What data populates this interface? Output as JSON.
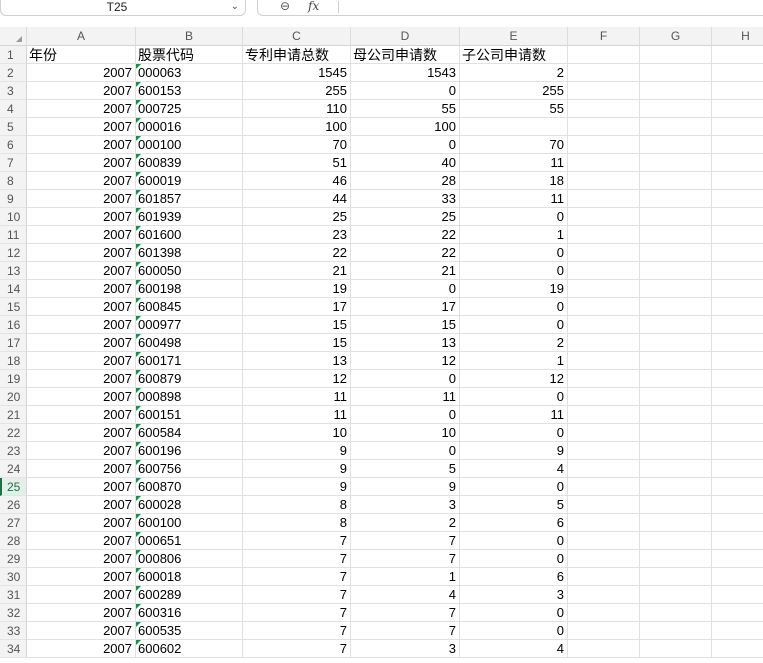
{
  "formula_bar": {
    "name_box": "T25",
    "fx_label": "fx"
  },
  "columns": [
    "A",
    "B",
    "C",
    "D",
    "E",
    "F",
    "G",
    "H"
  ],
  "header_row": {
    "row_number": "1",
    "cells": [
      "年份",
      "股票代码",
      "专利申请总数",
      "母公司申请数",
      "子公司申请数"
    ]
  },
  "active_row": "25",
  "rows": [
    {
      "n": "2",
      "year": "2007",
      "code": "000063",
      "total": "1545",
      "parent": "1543",
      "sub": "2"
    },
    {
      "n": "3",
      "year": "2007",
      "code": "600153",
      "total": "255",
      "parent": "0",
      "sub": "255"
    },
    {
      "n": "4",
      "year": "2007",
      "code": "000725",
      "total": "110",
      "parent": "55",
      "sub": "55"
    },
    {
      "n": "5",
      "year": "2007",
      "code": "000016",
      "total": "100",
      "parent": "100",
      "sub": ""
    },
    {
      "n": "6",
      "year": "2007",
      "code": "000100",
      "total": "70",
      "parent": "0",
      "sub": "70"
    },
    {
      "n": "7",
      "year": "2007",
      "code": "600839",
      "total": "51",
      "parent": "40",
      "sub": "11"
    },
    {
      "n": "8",
      "year": "2007",
      "code": "600019",
      "total": "46",
      "parent": "28",
      "sub": "18"
    },
    {
      "n": "9",
      "year": "2007",
      "code": "601857",
      "total": "44",
      "parent": "33",
      "sub": "11"
    },
    {
      "n": "10",
      "year": "2007",
      "code": "601939",
      "total": "25",
      "parent": "25",
      "sub": "0"
    },
    {
      "n": "11",
      "year": "2007",
      "code": "601600",
      "total": "23",
      "parent": "22",
      "sub": "1"
    },
    {
      "n": "12",
      "year": "2007",
      "code": "601398",
      "total": "22",
      "parent": "22",
      "sub": "0"
    },
    {
      "n": "13",
      "year": "2007",
      "code": "600050",
      "total": "21",
      "parent": "21",
      "sub": "0"
    },
    {
      "n": "14",
      "year": "2007",
      "code": "600198",
      "total": "19",
      "parent": "0",
      "sub": "19"
    },
    {
      "n": "15",
      "year": "2007",
      "code": "600845",
      "total": "17",
      "parent": "17",
      "sub": "0"
    },
    {
      "n": "16",
      "year": "2007",
      "code": "000977",
      "total": "15",
      "parent": "15",
      "sub": "0"
    },
    {
      "n": "17",
      "year": "2007",
      "code": "600498",
      "total": "15",
      "parent": "13",
      "sub": "2"
    },
    {
      "n": "18",
      "year": "2007",
      "code": "600171",
      "total": "13",
      "parent": "12",
      "sub": "1"
    },
    {
      "n": "19",
      "year": "2007",
      "code": "600879",
      "total": "12",
      "parent": "0",
      "sub": "12"
    },
    {
      "n": "20",
      "year": "2007",
      "code": "000898",
      "total": "11",
      "parent": "11",
      "sub": "0"
    },
    {
      "n": "21",
      "year": "2007",
      "code": "600151",
      "total": "11",
      "parent": "0",
      "sub": "11"
    },
    {
      "n": "22",
      "year": "2007",
      "code": "600584",
      "total": "10",
      "parent": "10",
      "sub": "0"
    },
    {
      "n": "23",
      "year": "2007",
      "code": "600196",
      "total": "9",
      "parent": "0",
      "sub": "9"
    },
    {
      "n": "24",
      "year": "2007",
      "code": "600756",
      "total": "9",
      "parent": "5",
      "sub": "4"
    },
    {
      "n": "25",
      "year": "2007",
      "code": "600870",
      "total": "9",
      "parent": "9",
      "sub": "0"
    },
    {
      "n": "26",
      "year": "2007",
      "code": "600028",
      "total": "8",
      "parent": "3",
      "sub": "5"
    },
    {
      "n": "27",
      "year": "2007",
      "code": "600100",
      "total": "8",
      "parent": "2",
      "sub": "6"
    },
    {
      "n": "28",
      "year": "2007",
      "code": "000651",
      "total": "7",
      "parent": "7",
      "sub": "0"
    },
    {
      "n": "29",
      "year": "2007",
      "code": "000806",
      "total": "7",
      "parent": "7",
      "sub": "0"
    },
    {
      "n": "30",
      "year": "2007",
      "code": "600018",
      "total": "7",
      "parent": "1",
      "sub": "6"
    },
    {
      "n": "31",
      "year": "2007",
      "code": "600289",
      "total": "7",
      "parent": "4",
      "sub": "3"
    },
    {
      "n": "32",
      "year": "2007",
      "code": "600316",
      "total": "7",
      "parent": "7",
      "sub": "0"
    },
    {
      "n": "33",
      "year": "2007",
      "code": "600535",
      "total": "7",
      "parent": "7",
      "sub": "0"
    },
    {
      "n": "34",
      "year": "2007",
      "code": "600602",
      "total": "7",
      "parent": "3",
      "sub": "4"
    }
  ],
  "colors": {
    "text_marker_green": "#1e8c45",
    "active_row_green": "#1e7145",
    "header_bg": "#f3f3f3"
  }
}
